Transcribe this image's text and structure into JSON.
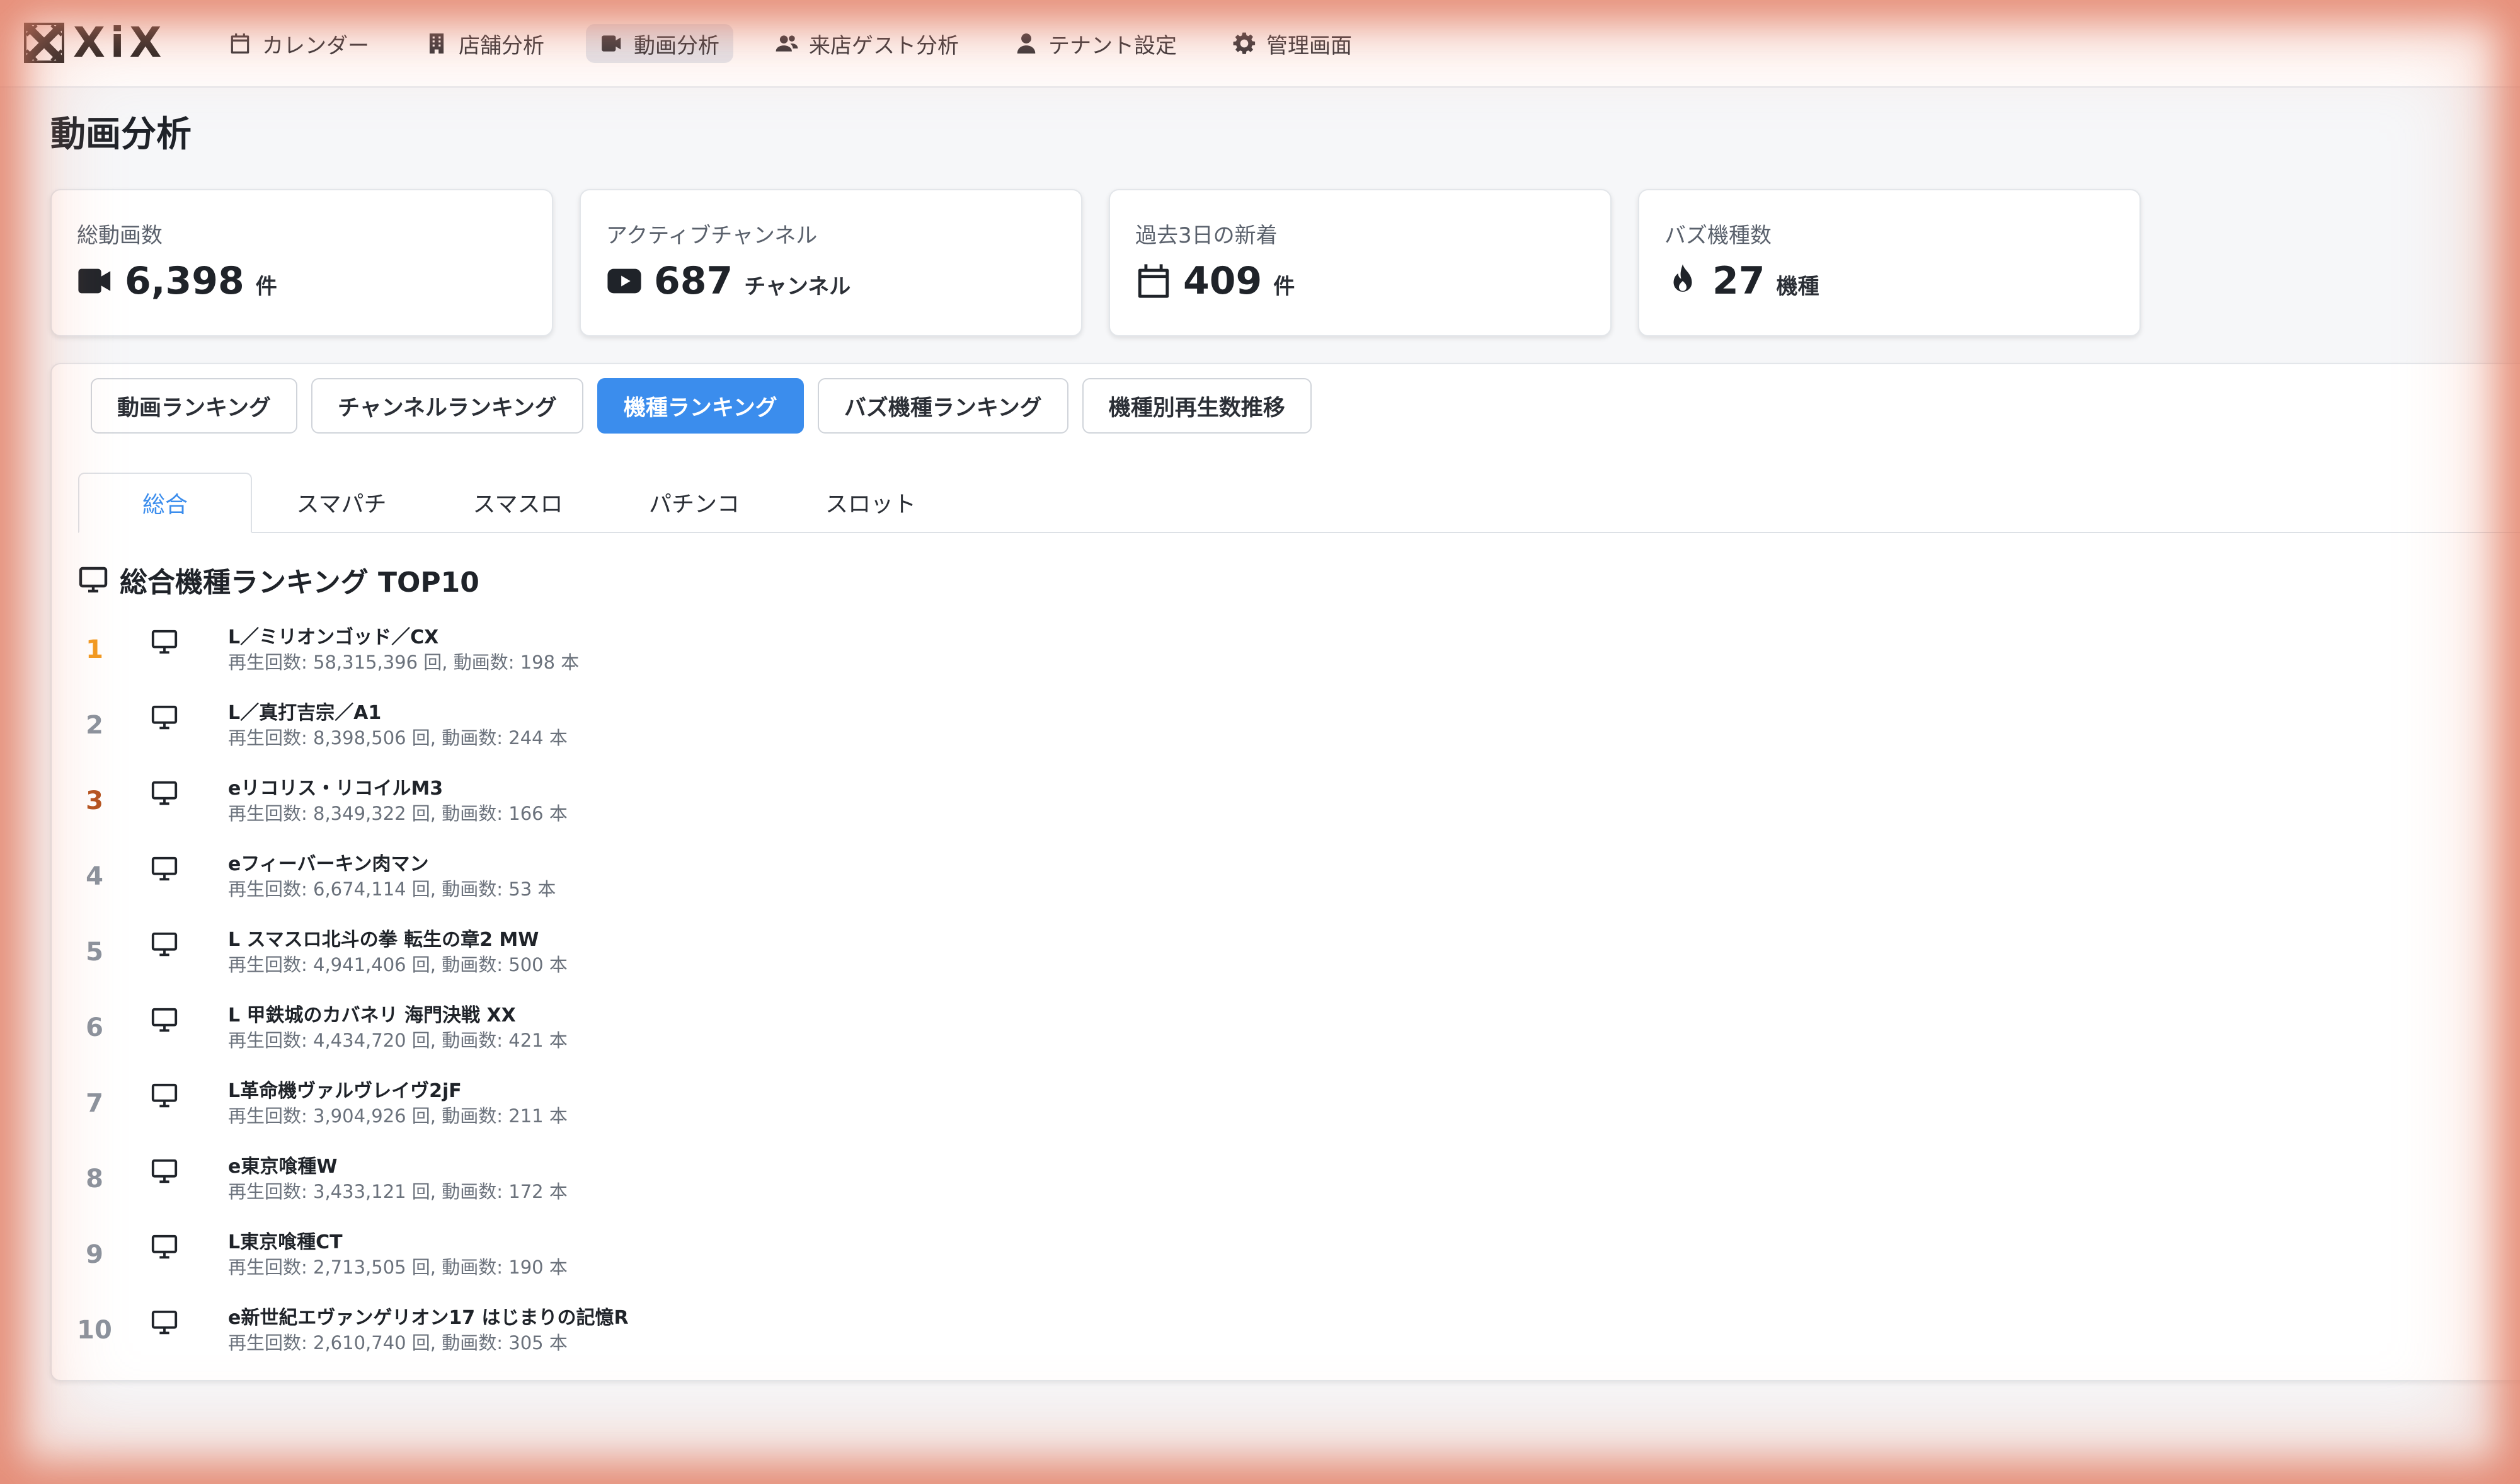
{
  "app": {
    "logo_text": "XiX"
  },
  "nav": {
    "items": [
      {
        "label": "カレンダー",
        "icon": "calendar-icon"
      },
      {
        "label": "店舗分析",
        "icon": "building-icon"
      },
      {
        "label": "動画分析",
        "icon": "video-camera-icon",
        "active": true
      },
      {
        "label": "来店ゲスト分析",
        "icon": "users-icon"
      },
      {
        "label": "テナント設定",
        "icon": "user-icon"
      },
      {
        "label": "管理画面",
        "icon": "gear-icon"
      }
    ]
  },
  "page": {
    "title": "動画分析"
  },
  "stats": [
    {
      "label": "総動画数",
      "value": "6,398",
      "unit": "件",
      "icon": "video-camera-icon"
    },
    {
      "label": "アクティブチャンネル",
      "value": "687",
      "unit": "チャンネル",
      "icon": "youtube-icon"
    },
    {
      "label": "過去3日の新着",
      "value": "409",
      "unit": "件",
      "icon": "calendar-icon"
    },
    {
      "label": "バズ機種数",
      "value": "27",
      "unit": "機種",
      "icon": "fire-icon"
    }
  ],
  "ranking_tabs": [
    {
      "label": "動画ランキング"
    },
    {
      "label": "チャンネルランキング"
    },
    {
      "label": "機種ランキング",
      "active": true
    },
    {
      "label": "バズ機種ランキング"
    },
    {
      "label": "機種別再生数推移"
    }
  ],
  "category_tabs": [
    {
      "label": "総合",
      "active": true
    },
    {
      "label": "スマパチ"
    },
    {
      "label": "スマスロ"
    },
    {
      "label": "パチンコ"
    },
    {
      "label": "スロット"
    }
  ],
  "section": {
    "title": "総合機種ランキング TOP10",
    "icon": "monitor-icon"
  },
  "ranking": {
    "meta_template": {
      "views_prefix": "再生回数: ",
      "views_unit": " 回, ",
      "videos_prefix": "動画数: ",
      "videos_unit": " 本"
    },
    "items": [
      {
        "rank": "1",
        "name": "L／ミリオンゴッド／CX",
        "views": "58,315,396",
        "videos": "198"
      },
      {
        "rank": "2",
        "name": "L／真打吉宗／A1",
        "views": "8,398,506",
        "videos": "244"
      },
      {
        "rank": "3",
        "name": "eリコリス・リコイルM3",
        "views": "8,349,322",
        "videos": "166"
      },
      {
        "rank": "4",
        "name": "eフィーバーキン肉マン",
        "views": "6,674,114",
        "videos": "53"
      },
      {
        "rank": "5",
        "name": "L スマスロ北斗の拳 転生の章2 MW",
        "views": "4,941,406",
        "videos": "500"
      },
      {
        "rank": "6",
        "name": "L 甲鉄城のカバネリ 海門決戦 XX",
        "views": "4,434,720",
        "videos": "421"
      },
      {
        "rank": "7",
        "name": "L革命機ヴァルヴレイヴ2jF",
        "views": "3,904,926",
        "videos": "211"
      },
      {
        "rank": "8",
        "name": "e東京喰種W",
        "views": "3,433,121",
        "videos": "172"
      },
      {
        "rank": "9",
        "name": "L東京喰種CT",
        "views": "2,713,505",
        "videos": "190"
      },
      {
        "rank": "10",
        "name": "e新世紀エヴァンゲリオン17 はじまりの記憶R",
        "views": "2,610,740",
        "videos": "305"
      }
    ]
  },
  "colors": {
    "accent": "#3b8ded",
    "gold": "#f29a21",
    "bronze": "#b5531f",
    "muted_rank": "#8a929d"
  }
}
